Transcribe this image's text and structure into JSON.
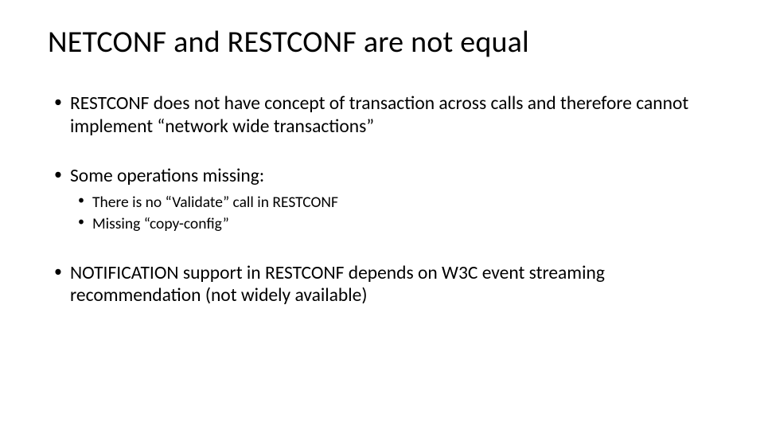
{
  "slide": {
    "title": "NETCONF and RESTCONF are not equal",
    "bullets": [
      {
        "text": "RESTCONF does not have concept of transaction across calls and therefore cannot implement “network wide transactions”"
      },
      {
        "text": "Some operations missing:",
        "sub": [
          "There is no “Validate” call in RESTCONF",
          "Missing “copy-config”"
        ]
      },
      {
        "text": "NOTIFICATION support in RESTCONF depends on W3C event streaming recommendation (not widely available)"
      }
    ]
  }
}
